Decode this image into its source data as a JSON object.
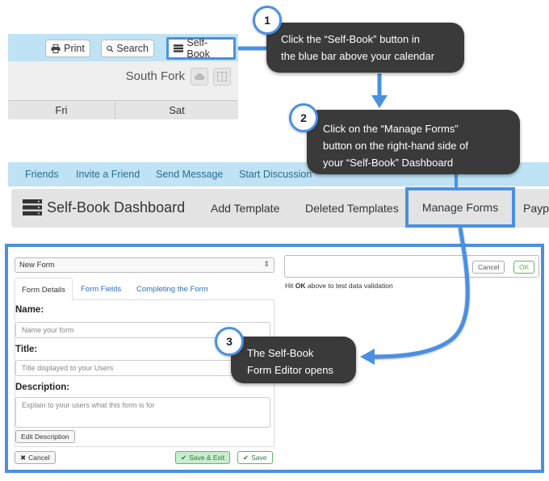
{
  "toolbar": {
    "print_label": "Print",
    "search_label": "Search",
    "selfbook_label": "Self-Book",
    "location": "South Fork",
    "days": [
      "Fri",
      "Sat"
    ]
  },
  "callouts": [
    {
      "number": "1",
      "text_line1": "Click the “Self-Book” button in",
      "text_line2": "the blue bar above your calendar"
    },
    {
      "number": "2",
      "text_line1": "Click on the “Manage Forms”",
      "text_line2": "button on the right-hand side of",
      "text_line3": "your “Self-Book” Dashboard"
    },
    {
      "number": "3",
      "text_line1": "The Self-Book",
      "text_line2": "Form Editor opens"
    }
  ],
  "nav": {
    "links": [
      "Friends",
      "Invite a Friend",
      "Send Message",
      "Start Discussion"
    ]
  },
  "dashboard": {
    "title": "Self-Book Dashboard",
    "links": [
      "Add Template",
      "Deleted Templates",
      "Manage Forms",
      "Payp"
    ]
  },
  "editor": {
    "form_select": "New Form",
    "tabs": [
      "Form Details",
      "Form Fields",
      "Completing the Form"
    ],
    "name_label": "Name:",
    "name_placeholder": "Name your form",
    "title_label": "Title:",
    "title_placeholder": "Title displayed to your Users",
    "description_label": "Description:",
    "description_placeholder": "Explain to your users what this form is for",
    "edit_description": "Edit Description",
    "cancel": "Cancel",
    "save_exit": "Save & Exit",
    "save": "Save",
    "test_cancel": "Cancel",
    "test_ok": "OK",
    "hint_pre": "Hit ",
    "hint_bold": "OK",
    "hint_post": " above to test data validation"
  },
  "colors": {
    "accent": "#4a90e2",
    "blue_bar": "#bfe3f5",
    "callout_bg": "#3a3a3a",
    "success_green": "#5cb85c"
  }
}
